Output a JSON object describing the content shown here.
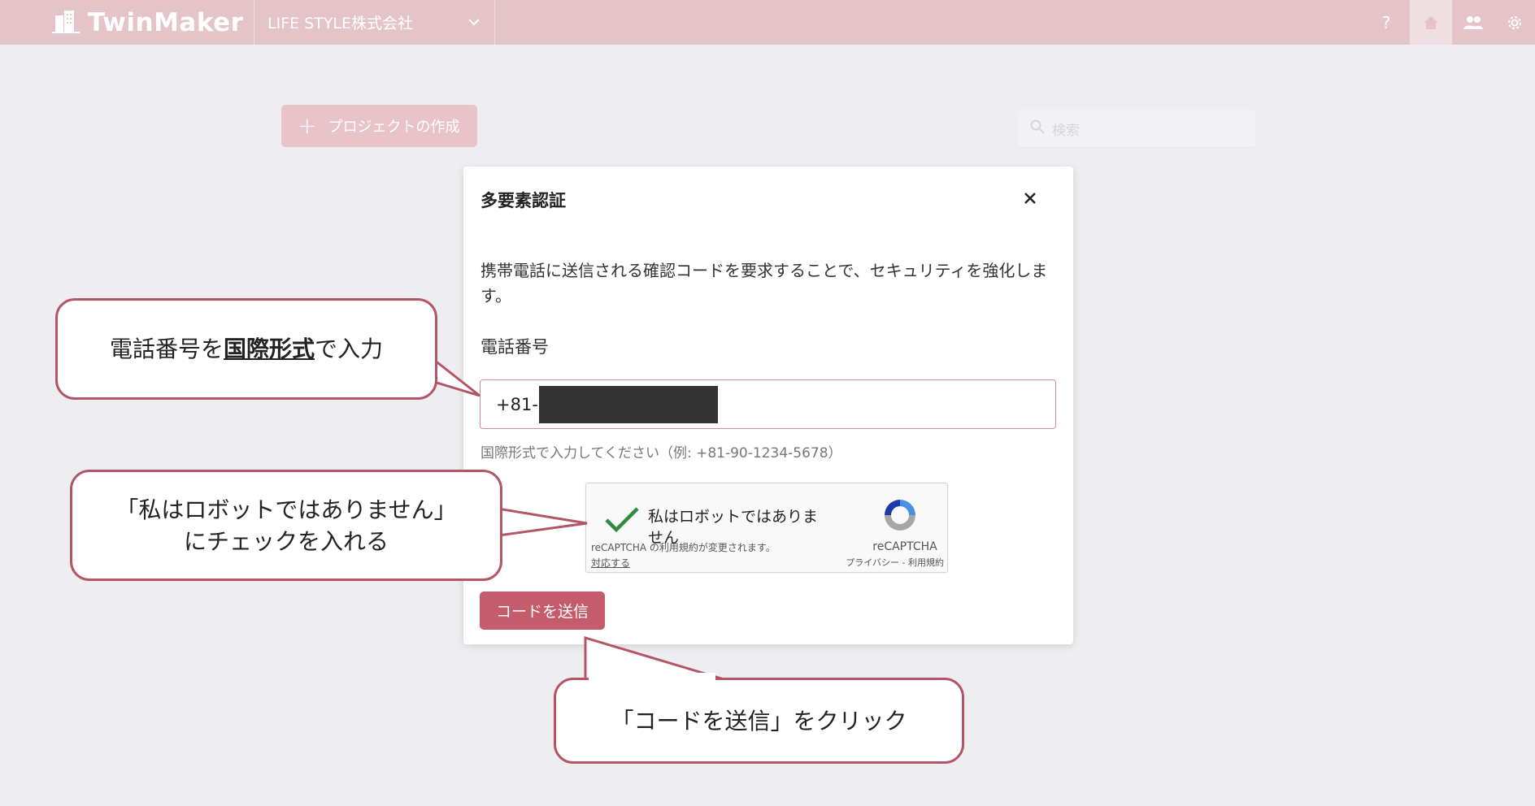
{
  "header": {
    "logo_text": "TwinMaker",
    "company": "LIFE STYLE株式会社",
    "help_label": "?"
  },
  "page": {
    "create_project_label": "プロジェクトの作成",
    "search_placeholder": "検索"
  },
  "modal": {
    "title": "多要素認証",
    "description": "携帯電話に送信される確認コードを要求することで、セキュリティを強化します。",
    "phone_label": "電話番号",
    "phone_prefix": "+81-",
    "helper_text": "国際形式で入力してください（例: +81-90-1234-5678）",
    "recaptcha": {
      "label": "私はロボットではありません",
      "notice": "reCAPTCHA の利用規約が変更されます。",
      "notice_link": "対応する",
      "brand": "reCAPTCHA",
      "links": "プライバシー - 利用規約"
    },
    "send_button": "コードを送信"
  },
  "callouts": {
    "phone_pre": "電話番号を",
    "phone_em": "国際形式",
    "phone_post": "で入力",
    "robot_line1": "「私はロボットではありません」",
    "robot_line2": "にチェックを入れる",
    "send": "「コードを送信」をクリック"
  },
  "colors": {
    "header": "#e4c3c9",
    "accent": "#c45c6b",
    "callout_border": "#b45566"
  }
}
